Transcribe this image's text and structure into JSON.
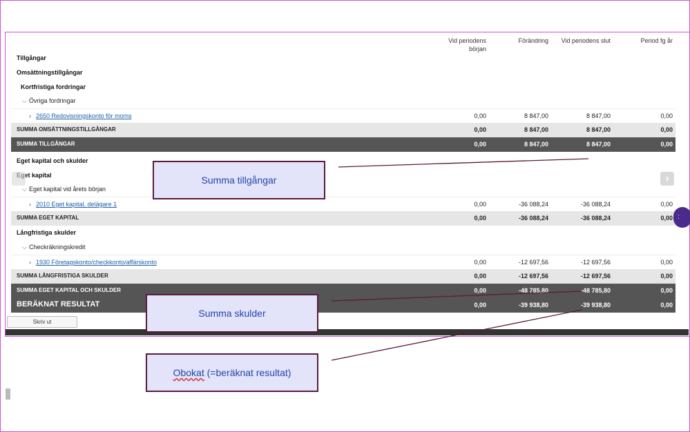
{
  "columns": [
    "Vid periodens\nbörjan",
    "Förändring",
    "Vid periodens slut",
    "Period fg år"
  ],
  "rows": [
    {
      "label": "Tillgångar",
      "type": "head",
      "values": [
        "",
        "",
        "",
        ""
      ]
    },
    {
      "label": "Omsättningstillgångar",
      "type": "head",
      "values": [
        "",
        "",
        "",
        ""
      ]
    },
    {
      "label": "Kortfristiga fordringar",
      "type": "head",
      "values": [
        "",
        "",
        "",
        ""
      ]
    },
    {
      "label": "Övriga fordringar",
      "type": "group",
      "values": [
        "",
        "",
        "",
        ""
      ]
    },
    {
      "label": "2650 Redovisningskonto för moms",
      "type": "item",
      "values": [
        "0,00",
        "8 847,00",
        "8 847,00",
        "0,00"
      ]
    },
    {
      "label": "SUMMA OMSÄTTNINGSTILLGÅNGAR",
      "type": "sum",
      "values": [
        "0,00",
        "8 847,00",
        "8 847,00",
        "0,00"
      ]
    },
    {
      "label": "SUMMA TILLGÅNGAR",
      "type": "dark",
      "values": [
        "0,00",
        "8 847,00",
        "8 847,00",
        "0,00"
      ]
    },
    {
      "label": "Eget kapital och skulder",
      "type": "head",
      "values": [
        "",
        "",
        "",
        ""
      ]
    },
    {
      "label": "Eget kapital",
      "type": "head",
      "values": [
        "",
        "",
        "",
        ""
      ]
    },
    {
      "label": "Eget kapital vid årets början",
      "type": "group",
      "values": [
        "",
        "",
        "",
        ""
      ]
    },
    {
      "label": "2010 Eget kapital, delägare 1",
      "type": "item",
      "values": [
        "0,00",
        "-36 088,24",
        "-36 088,24",
        "0,00"
      ]
    },
    {
      "label": "SUMMA EGET KAPITAL",
      "type": "sum",
      "values": [
        "0,00",
        "-36 088,24",
        "-36 088,24",
        "0,00"
      ]
    },
    {
      "label": "Långfristiga skulder",
      "type": "head",
      "values": [
        "",
        "",
        "",
        ""
      ]
    },
    {
      "label": "Checkräkningskredit",
      "type": "group",
      "values": [
        "",
        "",
        "",
        ""
      ]
    },
    {
      "label": "1930 Företagskonto/checkkonto/affärskonto",
      "type": "item",
      "values": [
        "0,00",
        "-12 697,56",
        "-12 697,56",
        "0,00"
      ]
    },
    {
      "label": "SUMMA LÅNGFRISTIGA SKULDER",
      "type": "sum",
      "values": [
        "0,00",
        "-12 697,56",
        "-12 697,56",
        "0,00"
      ]
    },
    {
      "label": "SUMMA EGET KAPITAL OCH SKULDER",
      "type": "dark",
      "values": [
        "0,00",
        "-48 785,80",
        "-48 785,80",
        "0,00"
      ]
    },
    {
      "label": "BERÄKNAT RESULTAT",
      "type": "dark-big",
      "values": [
        "0,00",
        "-39 938,80",
        "-39 938,80",
        "0,00"
      ]
    }
  ],
  "print_button": "Skriv ut",
  "callouts": {
    "assets": "Summa tillgångar",
    "debts": "Summa skulder",
    "unbooked_word": "Obokat",
    "unbooked_rest": " (=beräknat resultat)"
  },
  "icons": {
    "nav_right": "chevron-right-icon",
    "nav_left": "chevron-left-icon",
    "expand": "chevron-icon"
  },
  "colors": {
    "link": "#1a5fa8",
    "dark_row": "#555555",
    "sum_row": "#e6e6e6",
    "callout_bg": "#e3e3fa",
    "callout_border": "#5a1a3a",
    "frame": "#d24fd2"
  }
}
